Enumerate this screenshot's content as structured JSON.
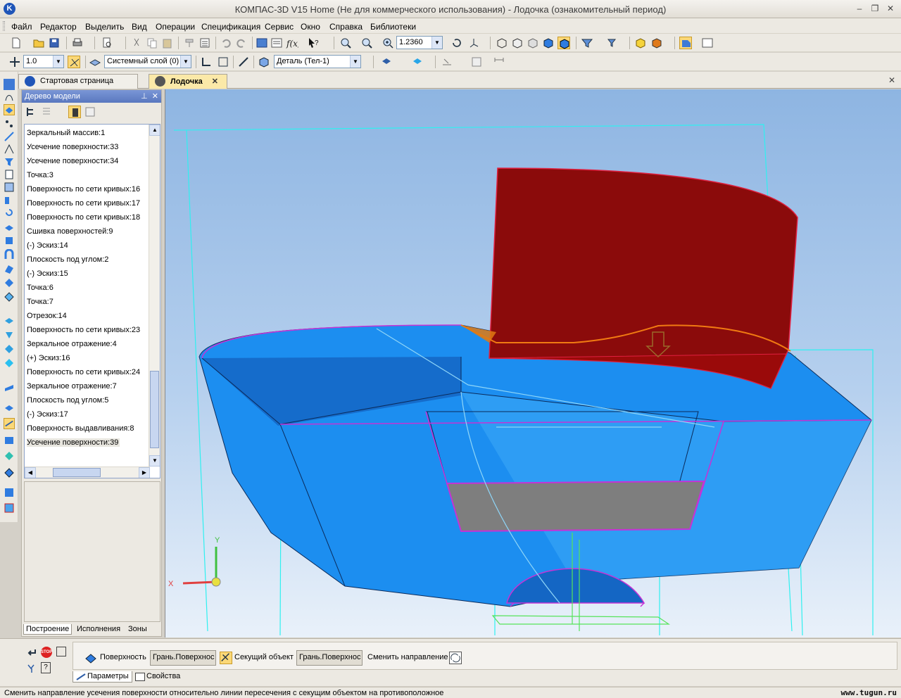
{
  "window": {
    "title": "КОМПАС-3D V15 Home (Не для коммерческого использования) - Лодочка (ознакомительный период)",
    "app_icon_letter": "K",
    "minimize_glyph": "–",
    "restore_glyph": "❐",
    "close_glyph": "✕"
  },
  "menu": [
    "Файл",
    "Редактор",
    "Выделить",
    "Вид",
    "Операции",
    "Спецификация",
    "Сервис",
    "Окно",
    "Справка",
    "Библиотеки"
  ],
  "toolbar": {
    "zoom_value": "1.2360",
    "line_scale": "1.0",
    "layer": "Системный слой (0)",
    "detail": "Деталь (Тел-1)"
  },
  "tabs": {
    "start_page": "Стартовая страница",
    "document": "Лодочка",
    "close_glyph": "✕"
  },
  "tree": {
    "title": "Дерево модели",
    "pin_glyph": "⊥",
    "close_glyph": "✕",
    "items": [
      "Зеркальный массив:1",
      "Усечение поверхности:33",
      "Усечение поверхности:34",
      "Точка:3",
      "Поверхность по сети кривых:16",
      "Поверхность по сети кривых:17",
      "Поверхность по сети кривых:18",
      "Сшивка поверхностей:9",
      "(-) Эскиз:14",
      "Плоскость под углом:2",
      "(-) Эскиз:15",
      "Точка:6",
      "Точка:7",
      "Отрезок:14",
      "Поверхность по сети кривых:23",
      "Зеркальное отражение:4",
      "(+) Эскиз:16",
      "Поверхность по сети кривых:24",
      "Зеркальное отражение:7",
      "Плоскость под углом:5",
      "(-) Эскиз:17",
      "Поверхность выдавливания:8",
      "Усечение поверхности:39"
    ],
    "selected_index": 22,
    "bottom_tabs": [
      "Построение",
      "Исполнения",
      "Зоны"
    ],
    "active_bottom_tab": 0,
    "scroll_up_glyph": "▲",
    "scroll_down_glyph": "▼",
    "scroll_left_glyph": "◀",
    "scroll_right_glyph": "▶"
  },
  "viewport": {
    "axis_x": "X",
    "axis_y": "Y",
    "colors": {
      "body_blue": "#1c8ef0",
      "body_dark": "#1466c4",
      "cut_surface": "#8b0b0b",
      "trim_face": "#7e7e7e",
      "sketch_magenta": "#c533d6",
      "plane_cyan": "#2ff0f0",
      "guide_green": "#56e35a",
      "orange_edge": "#f07a12"
    }
  },
  "properties": {
    "surface_label": "Поверхность",
    "surface_value": "Грань.Поверхнос",
    "cutting_object_label": "Секущий объект",
    "cutting_object_value": "Грань.Поверхнос",
    "change_direction_label": "Сменить направление",
    "tab_parameters": "Параметры",
    "tab_properties": "Свойства",
    "stop_text": "STOP"
  },
  "status": {
    "text": "Сменить направление усечения поверхности относительно линии пересечения с секущим объектом на противоположное",
    "watermark": "www.tugun.ru"
  }
}
